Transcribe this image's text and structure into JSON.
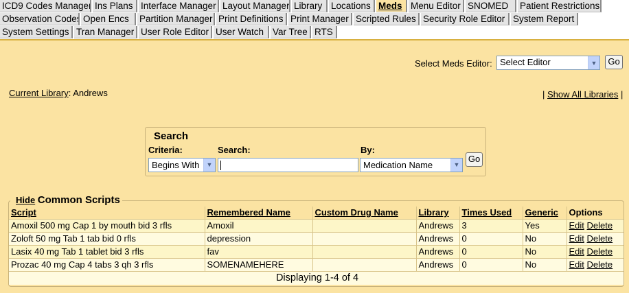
{
  "tabs": {
    "row1": [
      "ICD9 Codes Manager",
      "Ins Plans",
      "Interface Manager",
      "Layout Manager",
      "Library",
      "Locations",
      "Meds",
      "Menu Editor",
      "SNOMED",
      "Patient Restrictions"
    ],
    "row2": [
      "Observation Codes",
      "Open Encs",
      "Partition Manager",
      "Print Definitions",
      "Print Manager",
      "Scripted Rules",
      "Security Role Editor",
      "System Report"
    ],
    "row3": [
      "System Settings",
      "Tran Manager",
      "User Role Editor",
      "User Watch",
      "Var Tree",
      "RTS"
    ],
    "active": "Meds"
  },
  "editor": {
    "label": "Select Meds Editor:",
    "selected": "Select Editor",
    "go": "Go"
  },
  "library": {
    "label": "Current Library",
    "separator": ":",
    "value": "Andrews",
    "pipe_left": "|",
    "show_all": "Show All Libraries",
    "pipe_right": "|"
  },
  "search": {
    "title": "Search",
    "criteria_label": "Criteria:",
    "criteria_value": "Begins With",
    "search_label": "Search:",
    "search_value": "",
    "by_label": "By:",
    "by_value": "Medication Name",
    "go": "Go"
  },
  "scripts": {
    "hide": "Hide",
    "title": "Common Scripts",
    "columns": [
      "Script",
      "Remembered Name",
      "Custom Drug Name",
      "Library",
      "Times Used",
      "Generic",
      "Options"
    ],
    "rows": [
      [
        "Amoxil 500 mg Cap 1 by mouth bid 3 rfls",
        "Amoxil",
        "",
        "Andrews",
        "3",
        "Yes"
      ],
      [
        "Zoloft 50 mg Tab 1 tab bid 0 rfls",
        "depression",
        "",
        "Andrews",
        "0",
        "No"
      ],
      [
        "Lasix 40 mg Tab 1 tablet bid 3 rfls",
        "fav",
        "",
        "Andrews",
        "0",
        "No"
      ],
      [
        "Prozac 40 mg Cap 4 tabs 3 qh 3 rfls",
        "SOMENAMEHERE",
        "",
        "Andrews",
        "0",
        "No"
      ]
    ],
    "edit_label": "Edit",
    "delete_label": "Delete",
    "footer": "Displaying 1-4 of 4"
  },
  "colors": {
    "background": "#fbe3a2",
    "tab": "#e4e4e4",
    "row_odd": "#fdf6c8",
    "row_even": "#fffbe0"
  },
  "icons": {
    "dropdown": "chevron-down-icon"
  }
}
